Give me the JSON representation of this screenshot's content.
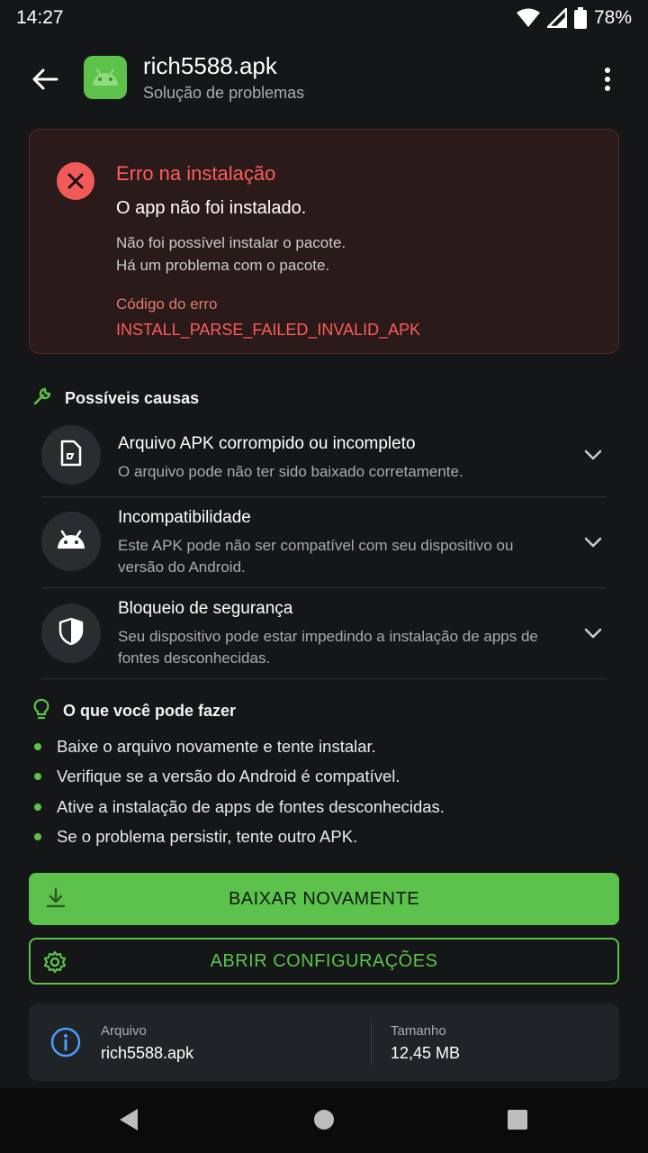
{
  "status": {
    "time": "14:27",
    "battery": "78%"
  },
  "header": {
    "title": "rich5588.apk",
    "subtitle": "Solução de problemas"
  },
  "error": {
    "title": "Erro na instalação",
    "headline": "O app não foi instalado.",
    "desc_line1": "Não foi possível instalar o pacote.",
    "desc_line2": "Há um problema com o pacote.",
    "code_label": "Código do erro",
    "code": "INSTALL_PARSE_FAILED_INVALID_APK"
  },
  "causes": {
    "heading": "Possíveis causas",
    "items": [
      {
        "title": "Arquivo APK corrompido ou incompleto",
        "desc": "O arquivo pode não ter sido baixado corretamente.",
        "icon": "file-icon"
      },
      {
        "title": "Incompatibilidade",
        "desc": "Este APK pode não ser compatível com seu dispositivo ou versão do Android.",
        "icon": "android-icon"
      },
      {
        "title": "Bloqueio de segurança",
        "desc": "Seu dispositivo pode estar impedindo a instalação de apps de fontes desconhecidas.",
        "icon": "shield-icon"
      }
    ]
  },
  "tips": {
    "heading": "O que você pode fazer",
    "items": [
      "Baixe o arquivo novamente e tente instalar.",
      "Verifique se a versão do Android é compatível.",
      "Ative a instalação de apps de fontes desconhecidas.",
      "Se o problema persistir, tente outro APK."
    ]
  },
  "actions": {
    "download_label": "BAIXAR NOVAMENTE",
    "settings_label": "ABRIR CONFIGURAÇÕES"
  },
  "file_info": {
    "file_label": "Arquivo",
    "file_value": "rich5588.apk",
    "size_label": "Tamanho",
    "size_value": "12,45 MB"
  },
  "colors": {
    "accent": "#5cc24b",
    "error": "#ff5d5d",
    "background": "#141617"
  }
}
